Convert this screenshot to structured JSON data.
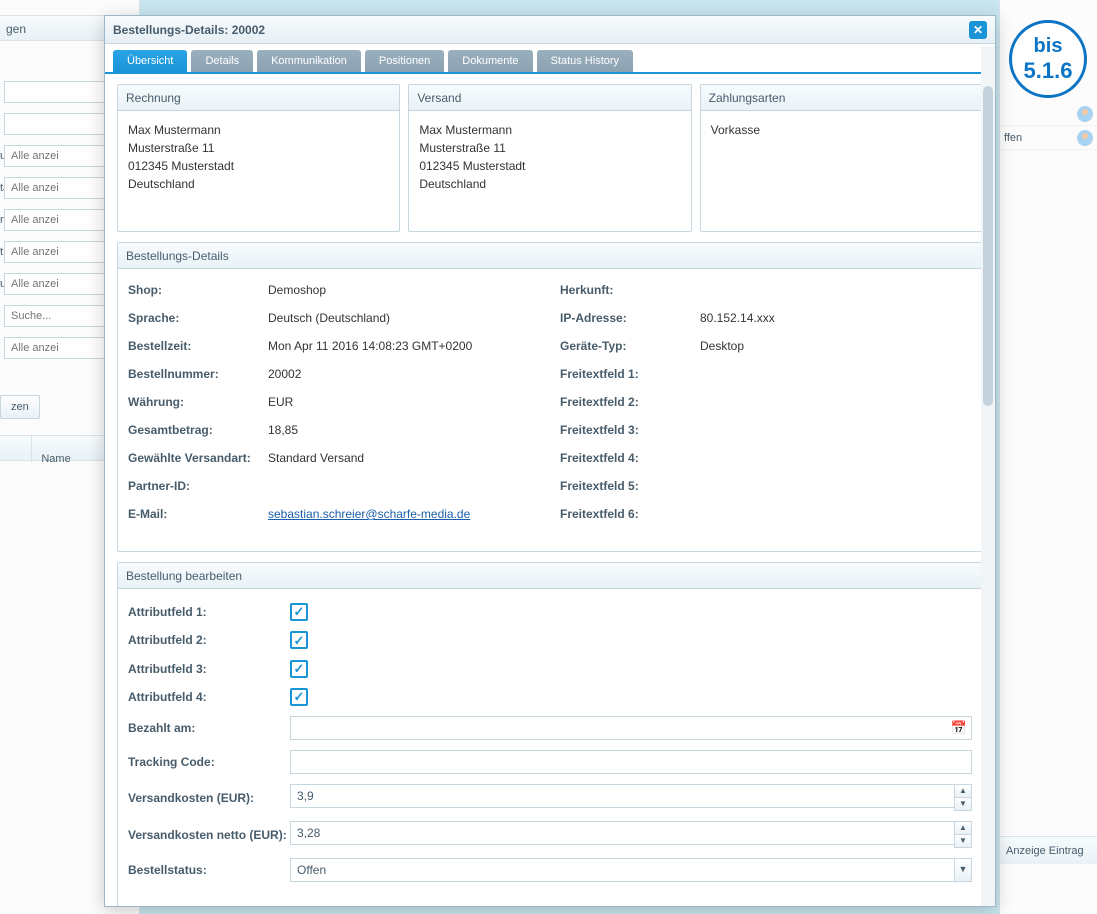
{
  "version_badge": {
    "line1": "bis",
    "line2": "5.1.6"
  },
  "bg": {
    "top_fragment": "gen",
    "labels": [
      "",
      "",
      "us:",
      "tatus:",
      "rt:",
      "t:",
      "uppe:",
      "",
      ""
    ],
    "placeholders": [
      "",
      "",
      "Alle anzei",
      "Alle anzei",
      "Alle anzei",
      "Alle anzei",
      "Alle anzei",
      "Suche...",
      "Alle anzei"
    ],
    "button": "zen",
    "grid_col2": "Name",
    "right_row1": "ffen",
    "right_foot": "Anzeige Eintrag"
  },
  "dialog": {
    "title": "Bestellungs-Details: 20002",
    "tabs": [
      "Übersicht",
      "Details",
      "Kommunikation",
      "Positionen",
      "Dokumente",
      "Status History"
    ],
    "active_tab_index": 0,
    "panels": {
      "billing_title": "Rechnung",
      "shipping_title": "Versand",
      "payment_title": "Zahlungsarten",
      "billing_address": "Max Mustermann\nMusterstraße 11\n012345 Musterstadt\nDeutschland",
      "shipping_address": "Max Mustermann\nMusterstraße 11\n012345 Musterstadt\nDeutschland",
      "payment_value": "Vorkasse"
    },
    "details": {
      "title": "Bestellungs-Details",
      "left": [
        {
          "k": "Shop:",
          "v": "Demoshop"
        },
        {
          "k": "Sprache:",
          "v": "Deutsch (Deutschland)"
        },
        {
          "k": "Bestellzeit:",
          "v": "Mon Apr 11 2016 14:08:23 GMT+0200"
        },
        {
          "k": "Bestellnummer:",
          "v": "20002"
        },
        {
          "k": "Währung:",
          "v": "EUR"
        },
        {
          "k": "Gesamtbetrag:",
          "v": "18,85"
        },
        {
          "k": "Gewählte Versandart:",
          "v": "Standard Versand"
        },
        {
          "k": "Partner-ID:",
          "v": ""
        },
        {
          "k": "E-Mail:",
          "v": "sebastian.schreier@scharfe-media.de",
          "link": true
        }
      ],
      "right": [
        {
          "k": "Herkunft:",
          "v": ""
        },
        {
          "k": "IP-Adresse:",
          "v": "80.152.14.xxx"
        },
        {
          "k": "Geräte-Typ:",
          "v": "Desktop"
        },
        {
          "k": "Freitextfeld 1:",
          "v": ""
        },
        {
          "k": "Freitextfeld 2:",
          "v": ""
        },
        {
          "k": "Freitextfeld 3:",
          "v": ""
        },
        {
          "k": "Freitextfeld 4:",
          "v": ""
        },
        {
          "k": "Freitextfeld 5:",
          "v": ""
        },
        {
          "k": "Freitextfeld 6:",
          "v": ""
        }
      ]
    },
    "edit": {
      "title": "Bestellung bearbeiten",
      "attr1": "Attributfeld 1:",
      "attr2": "Attributfeld 2:",
      "attr3": "Attributfeld 3:",
      "attr4": "Attributfeld 4:",
      "paid_on": "Bezahlt am:",
      "tracking": "Tracking Code:",
      "ship_cost": "Versandkosten (EUR):",
      "ship_cost_net": "Versandkosten netto (EUR):",
      "order_status": "Bestellstatus:",
      "ship_cost_val": "3,9",
      "ship_cost_net_val": "3,28",
      "order_status_val": "Offen"
    }
  }
}
